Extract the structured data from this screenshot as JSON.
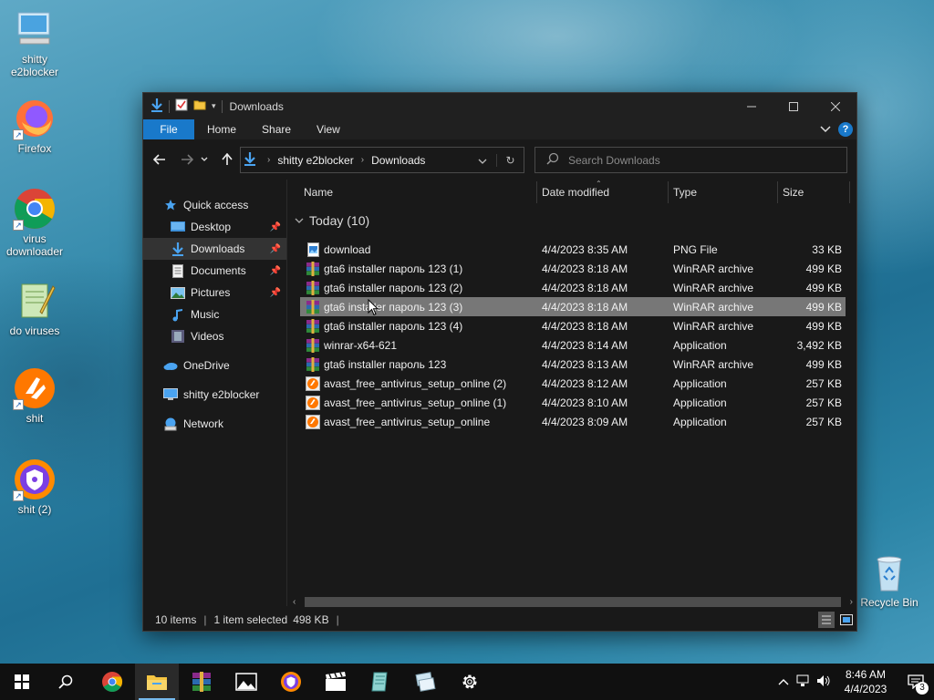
{
  "desktop": {
    "icons": [
      {
        "label": "shitty\ne2blocker",
        "icon": "computer-icon"
      },
      {
        "label": "Firefox",
        "icon": "firefox-icon"
      },
      {
        "label": "virus\ndownloader",
        "icon": "chrome-icon"
      },
      {
        "label": "do viruses",
        "icon": "notepad-icon"
      },
      {
        "label": "shit",
        "icon": "avast-icon"
      },
      {
        "label": "shit (2)",
        "icon": "avast-secure-browser-icon"
      },
      {
        "label": "Recycle Bin",
        "icon": "recycle-bin-icon"
      }
    ]
  },
  "explorer": {
    "title": "Downloads",
    "ribbon_tabs": [
      "File",
      "Home",
      "Share",
      "View"
    ],
    "breadcrumb": [
      "shitty e2blocker",
      "Downloads"
    ],
    "search_placeholder": "Search Downloads",
    "sidebar": [
      {
        "label": "Quick access",
        "icon": "star-icon",
        "pinned": false
      },
      {
        "label": "Desktop",
        "icon": "desktop-folder-icon",
        "pinned": true
      },
      {
        "label": "Downloads",
        "icon": "downloads-folder-icon",
        "pinned": true,
        "selected": true
      },
      {
        "label": "Documents",
        "icon": "documents-folder-icon",
        "pinned": true
      },
      {
        "label": "Pictures",
        "icon": "pictures-folder-icon",
        "pinned": true
      },
      {
        "label": "Music",
        "icon": "music-folder-icon",
        "pinned": false
      },
      {
        "label": "Videos",
        "icon": "videos-folder-icon",
        "pinned": false
      },
      {
        "label": "OneDrive",
        "icon": "onedrive-icon",
        "pinned": false
      },
      {
        "label": "shitty e2blocker",
        "icon": "this-pc-icon",
        "pinned": false
      },
      {
        "label": "Network",
        "icon": "network-icon",
        "pinned": false
      }
    ],
    "columns": [
      "Name",
      "Date modified",
      "Type",
      "Size"
    ],
    "group_label": "Today (10)",
    "files": [
      {
        "name": "download",
        "date": "4/4/2023 8:35 AM",
        "type": "PNG File",
        "size": "33 KB",
        "icon": "png-file-icon"
      },
      {
        "name": "gta6 installer пароль 123 (1)",
        "date": "4/4/2023 8:18 AM",
        "type": "WinRAR archive",
        "size": "499 KB",
        "icon": "winrar-archive-icon"
      },
      {
        "name": "gta6 installer пароль 123 (2)",
        "date": "4/4/2023 8:18 AM",
        "type": "WinRAR archive",
        "size": "499 KB",
        "icon": "winrar-archive-icon"
      },
      {
        "name": "gta6 installer пароль 123 (3)",
        "date": "4/4/2023 8:18 AM",
        "type": "WinRAR archive",
        "size": "499 KB",
        "icon": "winrar-archive-icon",
        "selected": true
      },
      {
        "name": "gta6 installer пароль 123 (4)",
        "date": "4/4/2023 8:18 AM",
        "type": "WinRAR archive",
        "size": "499 KB",
        "icon": "winrar-archive-icon"
      },
      {
        "name": "winrar-x64-621",
        "date": "4/4/2023 8:14 AM",
        "type": "Application",
        "size": "3,492 KB",
        "icon": "winrar-archive-icon"
      },
      {
        "name": "gta6 installer пароль 123",
        "date": "4/4/2023 8:13 AM",
        "type": "WinRAR archive",
        "size": "499 KB",
        "icon": "winrar-archive-icon"
      },
      {
        "name": "avast_free_antivirus_setup_online (2)",
        "date": "4/4/2023 8:12 AM",
        "type": "Application",
        "size": "257 KB",
        "icon": "avast-setup-icon"
      },
      {
        "name": "avast_free_antivirus_setup_online (1)",
        "date": "4/4/2023 8:10 AM",
        "type": "Application",
        "size": "257 KB",
        "icon": "avast-setup-icon"
      },
      {
        "name": "avast_free_antivirus_setup_online",
        "date": "4/4/2023 8:09 AM",
        "type": "Application",
        "size": "257 KB",
        "icon": "avast-setup-icon"
      }
    ],
    "status": {
      "items": "10 items",
      "selected": "1 item selected",
      "size": "498 KB"
    }
  },
  "taskbar": {
    "apps": [
      "start-icon",
      "search-icon",
      "chrome-icon",
      "file-explorer-icon",
      "winrar-icon",
      "photos-icon",
      "avast-secure-browser-icon",
      "movies-icon",
      "notepad-icon",
      "network-tool-icon",
      "settings-icon"
    ],
    "time": "8:46 AM",
    "date": "4/4/2023",
    "notification_count": "3"
  },
  "colors": {
    "accent": "#1979ca",
    "window_bg": "#191919",
    "selected_row": "#777777"
  }
}
